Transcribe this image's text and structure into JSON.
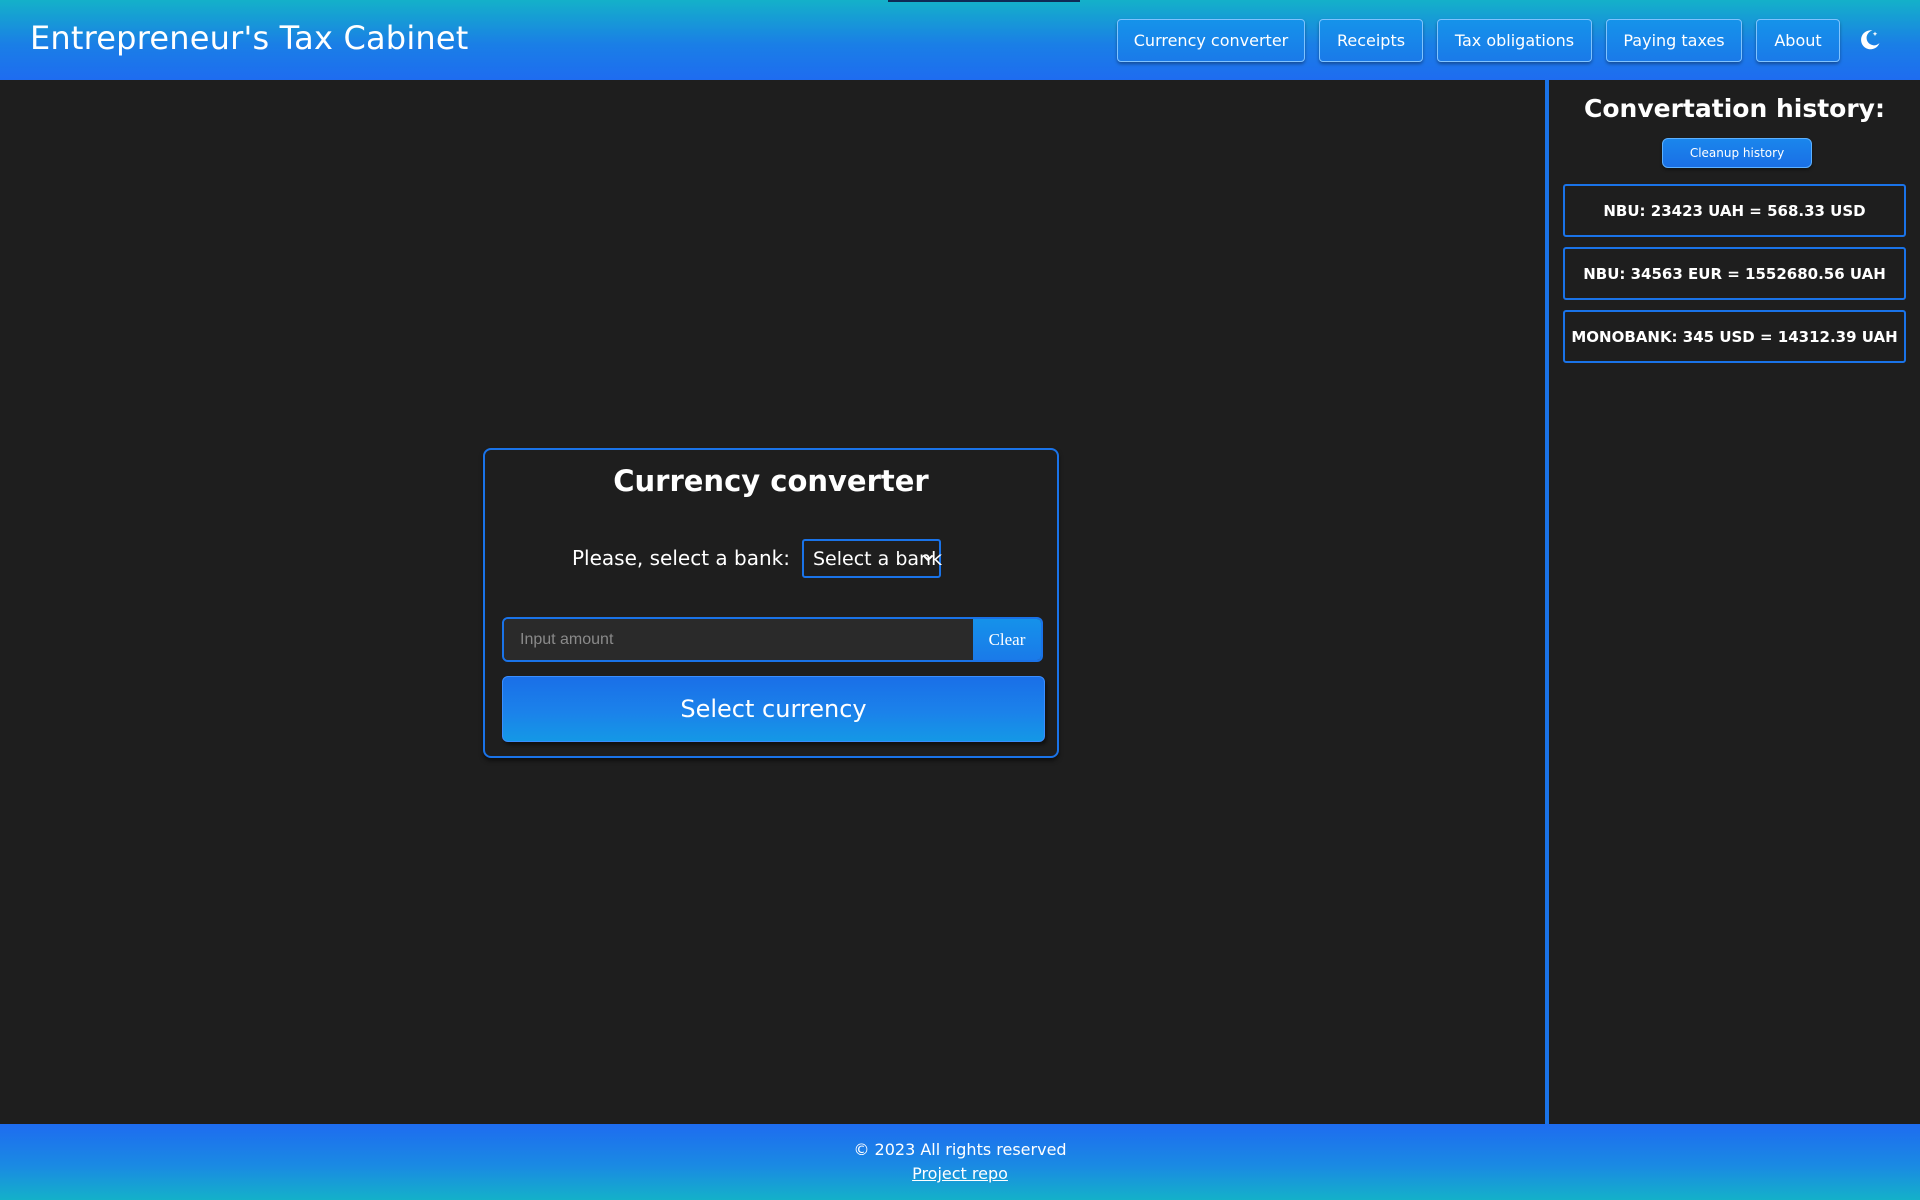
{
  "header": {
    "title": "Entrepreneur's Tax Cabinet",
    "nav": [
      {
        "label": "Currency converter"
      },
      {
        "label": "Receipts"
      },
      {
        "label": "Tax obligations"
      },
      {
        "label": "Paying taxes"
      },
      {
        "label": "About"
      }
    ],
    "theme_toggle_icon": "moon-icon"
  },
  "converter": {
    "title": "Currency converter",
    "bank_label": "Please, select a bank:",
    "bank_select_value": "Select a bank",
    "amount_placeholder": "Input amount",
    "amount_value": "",
    "clear_label": "Clear",
    "select_currency_label": "Select currency"
  },
  "history": {
    "title": "Convertation history:",
    "cleanup_label": "Cleanup history",
    "items": [
      {
        "text": "NBU: 23423 UAH = 568.33 USD"
      },
      {
        "text": "NBU: 34563 EUR = 1552680.56 UAH"
      },
      {
        "text": "MONOBANK: 345 USD = 14312.39 UAH"
      }
    ]
  },
  "footer": {
    "copyright": "© 2023 All rights reserved",
    "repo_link": "Project repo"
  },
  "colors": {
    "accent": "#1a73e8",
    "background": "#1e1e1e",
    "header_gradient_top": "#14b1c9",
    "header_gradient_bottom": "#1e6cf0"
  }
}
